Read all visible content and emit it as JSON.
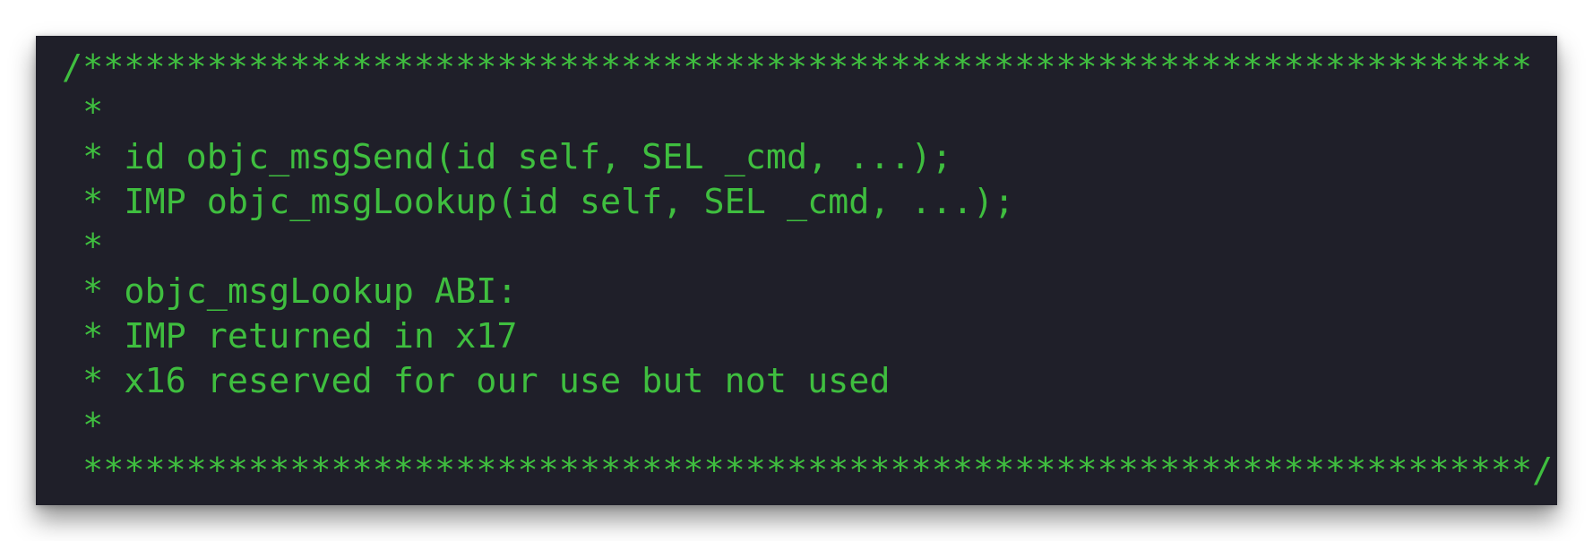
{
  "code_block": {
    "colors": {
      "background": "#1f1f29",
      "text": "#3fbe3f"
    },
    "lines": [
      "/**********************************************************************",
      " *",
      " * id objc_msgSend(id self, SEL _cmd, ...);",
      " * IMP objc_msgLookup(id self, SEL _cmd, ...);",
      " *",
      " * objc_msgLookup ABI:",
      " * IMP returned in x17",
      " * x16 reserved for our use but not used",
      " *",
      " **********************************************************************/"
    ]
  }
}
